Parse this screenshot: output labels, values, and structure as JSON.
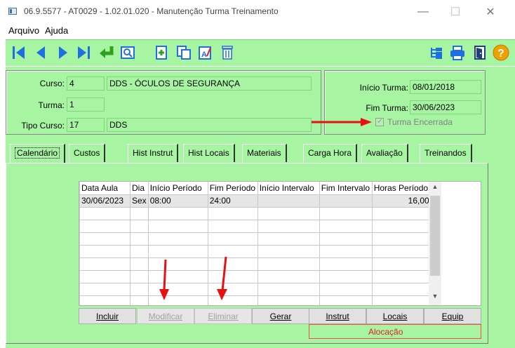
{
  "window": {
    "title": "06.9.5577 - AT0029 - 1.02.01.020 - Manutenção Turma Treinamento",
    "min": "—",
    "max": "☐",
    "close": "✕"
  },
  "menu": {
    "arquivo": "Arquivo",
    "ajuda": "Ajuda"
  },
  "toolbar": {
    "icons": [
      "first-record-icon",
      "prev-record-icon",
      "next-record-icon",
      "last-record-icon",
      "return-icon",
      "search-icon",
      "new-icon",
      "copy-icon",
      "edit-icon",
      "delete-icon",
      "tree-icon",
      "print-icon",
      "exit-icon",
      "help-icon"
    ],
    "help_glyph": "?"
  },
  "header": {
    "curso_label": "Curso:",
    "curso_code": "4",
    "curso_name": "DDS - ÓCULOS DE SEGURANÇA",
    "turma_label": "Turma:",
    "turma_value": "1",
    "tipo_label": "Tipo Curso:",
    "tipo_code": "17",
    "tipo_name": "DDS",
    "inicio_label": "Início Turma:",
    "inicio_value": "08/01/2018",
    "fim_label": "Fim Turma:",
    "fim_value": "30/06/2023",
    "encerrada_label": "Turma Encerrada",
    "encerrada_checked": true
  },
  "tabs": [
    "Calendário",
    "Custos",
    "Hist Instrut",
    "Hist Locais",
    "Materiais",
    "Carga Hora",
    "Avaliação",
    "Treinandos"
  ],
  "grid": {
    "columns": [
      "Data Aula",
      "Dia",
      "Início Período",
      "Fim Período",
      "Início Intervalo",
      "Fim Intervalo",
      "Horas Período"
    ],
    "rows": [
      [
        "30/06/2023",
        "Sex",
        "08:00",
        "24:00",
        "",
        "",
        "16,00"
      ]
    ],
    "scroll_up": "▲",
    "scroll_down": "▼"
  },
  "buttons": {
    "incluir": "Incluir",
    "modificar": "Modificar",
    "eliminar": "Eliminar",
    "gerar": "Gerar",
    "instrut": "Instrut",
    "locais": "Locais",
    "equip": "Equip"
  },
  "alocacao": "Alocação",
  "colors": {
    "panel_green": "#a7f5a3",
    "arrow_red": "#e81010",
    "icon_blue": "#1f6fe0"
  }
}
